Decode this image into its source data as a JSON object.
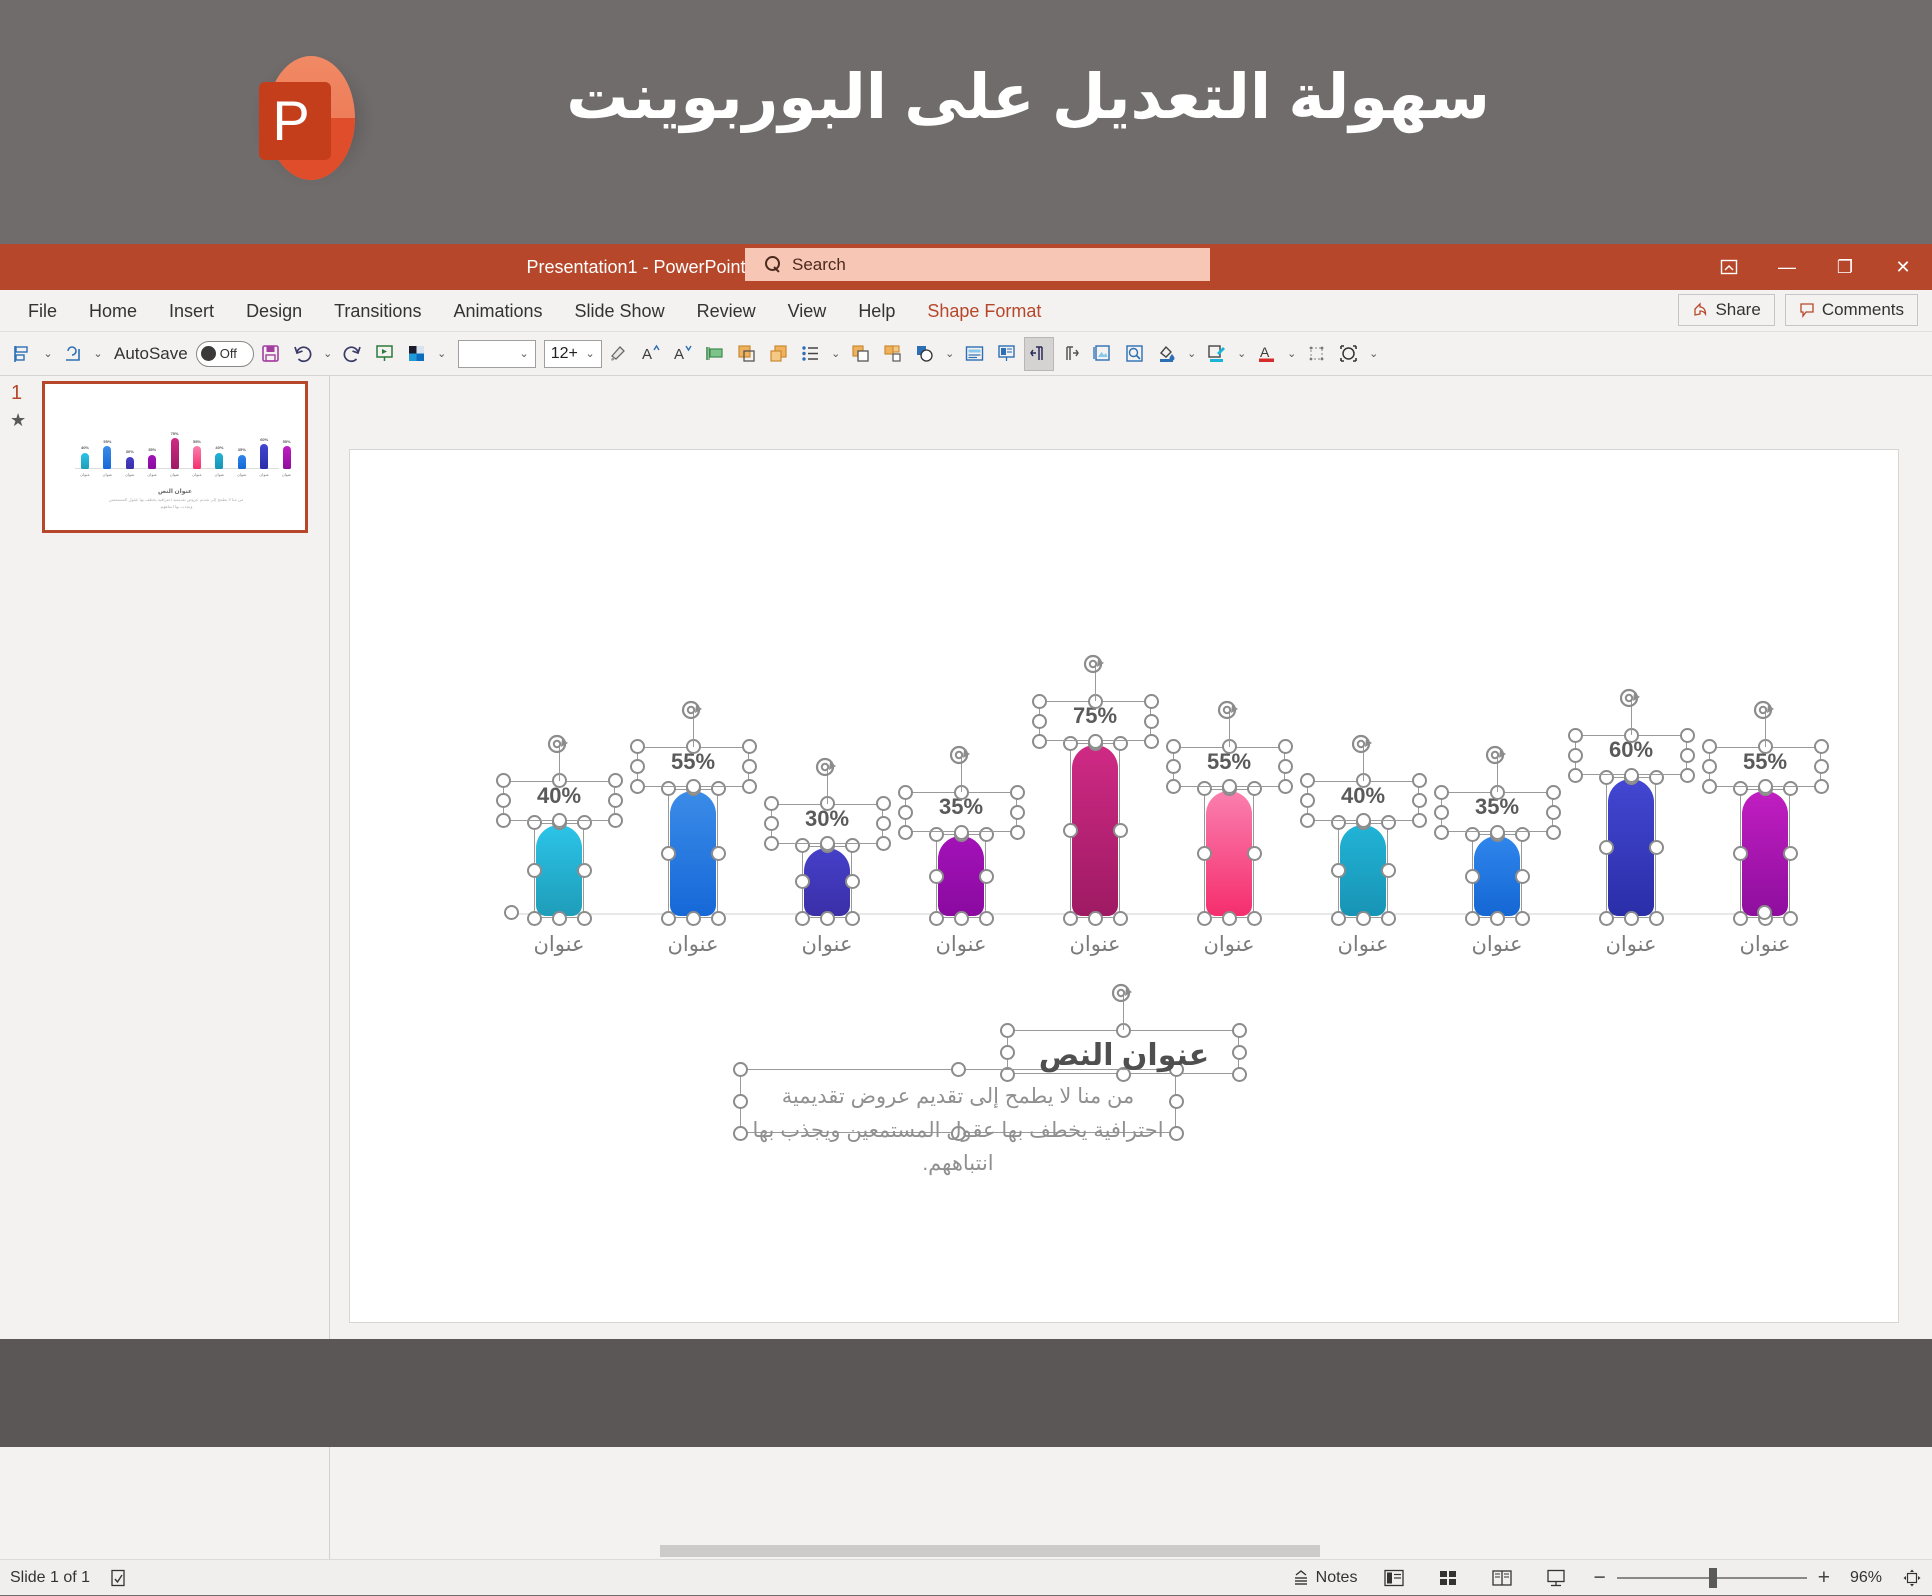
{
  "banner": {
    "title": "سهولة التعديل على البوربوينت",
    "logo_letter": "P"
  },
  "titlebar": {
    "document_title": "Presentation1  -  PowerPoint",
    "search_placeholder": "Search",
    "ribbon_display_icon": "ribbon-display-options-icon",
    "minimize": "—",
    "restore": "❐",
    "close": "✕"
  },
  "ribbon": {
    "tabs": [
      {
        "label": "File",
        "contextual": false
      },
      {
        "label": "Home",
        "contextual": false
      },
      {
        "label": "Insert",
        "contextual": false
      },
      {
        "label": "Design",
        "contextual": false
      },
      {
        "label": "Transitions",
        "contextual": false
      },
      {
        "label": "Animations",
        "contextual": false
      },
      {
        "label": "Slide Show",
        "contextual": false
      },
      {
        "label": "Review",
        "contextual": false
      },
      {
        "label": "View",
        "contextual": false
      },
      {
        "label": "Help",
        "contextual": false
      },
      {
        "label": "Shape Format",
        "contextual": true
      }
    ],
    "share_label": "Share",
    "comments_label": "Comments"
  },
  "toolbar": {
    "autosave_label": "AutoSave",
    "autosave_state": "Off",
    "font_value": "",
    "font_size_value": "12+",
    "items": [
      "align-objects-icon",
      "shape-effects-icon",
      "save-icon",
      "undo-icon",
      "redo-icon",
      "start-slideshow-icon",
      "theme-colors-icon",
      "format-painter-icon",
      "increase-font-icon",
      "decrease-font-icon",
      "text-direction-icon",
      "bring-forward-icon",
      "send-backward-icon",
      "bullets-icon",
      "align-left-icon",
      "group-objects-icon",
      "rotate-objects-icon",
      "insert-textbox-icon",
      "slide-layout-icon",
      "rtl-paragraph-icon",
      "ltr-paragraph-icon",
      "picture-format-icon",
      "selection-pane-icon",
      "shape-fill-icon",
      "shape-outline-icon",
      "font-color-icon",
      "align-distribute-icon",
      "crop-icon",
      "overflow-icon"
    ]
  },
  "slide_panel": {
    "slide_number": "1",
    "star_glyph": "★"
  },
  "chart_data": {
    "type": "bar",
    "title": "عنوان النص",
    "subtitle": "من منا لا يطمح إلى تقديم عروض تقديمية احترافية يخطف بها عقول المستمعين ويجذب بها انتباههم.",
    "categories": [
      "عنوان",
      "عنوان",
      "عنوان",
      "عنوان",
      "عنوان",
      "عنوان",
      "عنوان",
      "عنوان",
      "عنوان",
      "عنوان"
    ],
    "values": [
      40,
      55,
      30,
      35,
      75,
      55,
      40,
      35,
      60,
      55
    ],
    "value_labels": [
      "40%",
      "55%",
      "30%",
      "35%",
      "75%",
      "55%",
      "40%",
      "35%",
      "60%",
      "55%"
    ],
    "bar_colors_top": [
      "#2bc4e8",
      "#3b8ce8",
      "#4540c9",
      "#a312b8",
      "#cf2a85",
      "#fa7fae",
      "#21b3d6",
      "#2f86ec",
      "#4347d2",
      "#c11ec1"
    ],
    "bar_colors_bottom": [
      "#1f9db9",
      "#1668d8",
      "#3b2fa8",
      "#8a0aa0",
      "#9e1a63",
      "#f52e6e",
      "#1894b5",
      "#1567d4",
      "#2a2ea8",
      "#8e0e9e"
    ],
    "xlabel": "",
    "ylabel": "",
    "ylim": [
      0,
      80
    ],
    "grid": false,
    "legend": "none"
  },
  "statusbar": {
    "slide_indicator": "Slide 1 of 1",
    "accessibility_icon": "accessibility-checker-icon",
    "notes_label": "Notes",
    "view_normal_icon": "normal-view-icon",
    "view_sorter_icon": "slide-sorter-icon",
    "view_reading_icon": "reading-view-icon",
    "view_slideshow_icon": "slideshow-view-icon",
    "zoom_out": "−",
    "zoom_in": "+",
    "zoom_level": "96%",
    "fit_slide_icon": "fit-slide-to-window-icon"
  }
}
